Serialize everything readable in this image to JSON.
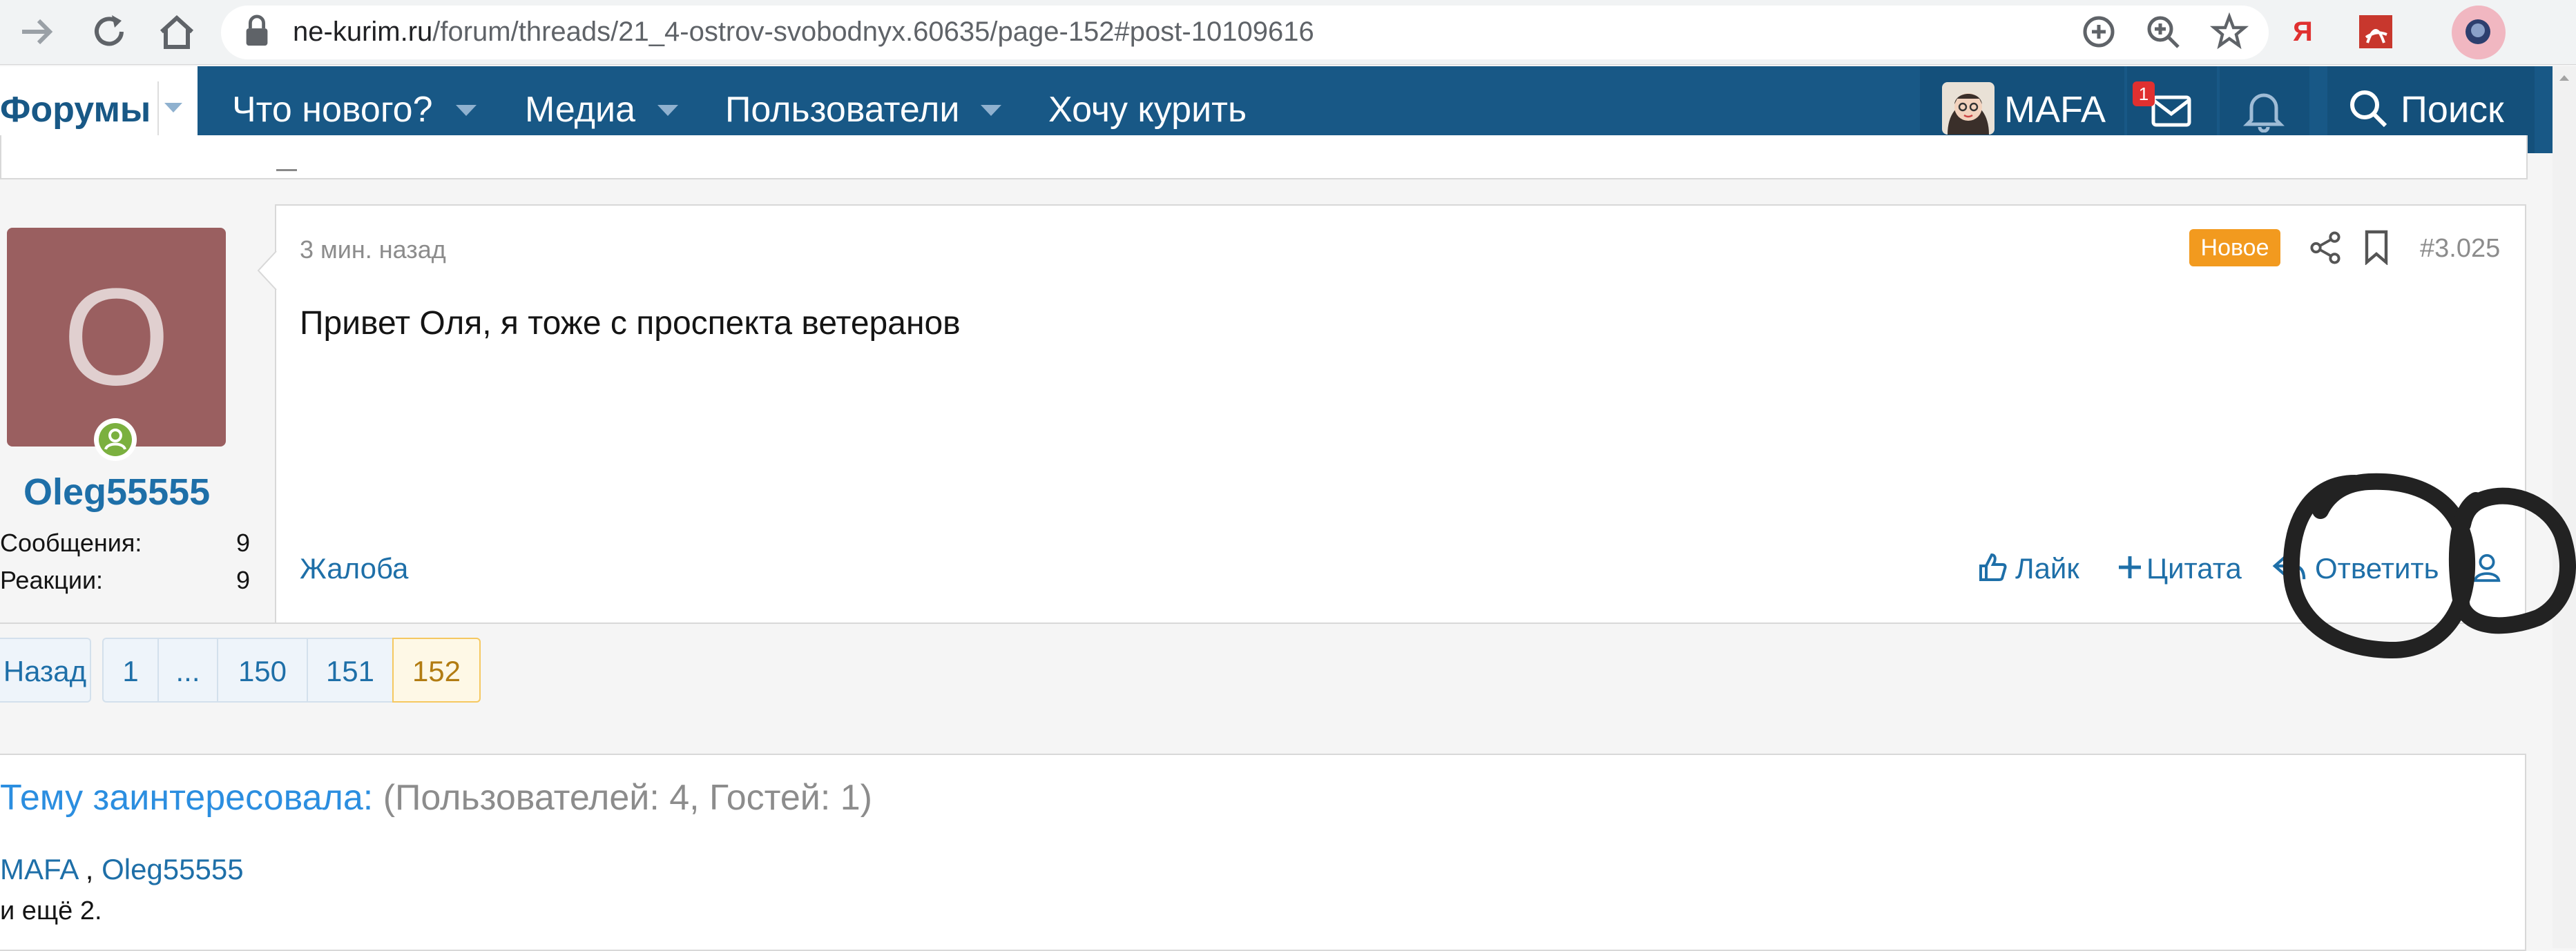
{
  "browser": {
    "url_host": "ne-kurim.ru",
    "url_path": "/forum/threads/21_4-ostrov-svobodnyx.60635/page-152#post-10109616",
    "yandex_glyph": "Я"
  },
  "forum_nav": {
    "forums_label": "Форумы",
    "items": [
      {
        "label": "Что нового?"
      },
      {
        "label": "Медиа"
      },
      {
        "label": "Пользователи"
      },
      {
        "label": "Хочу курить"
      }
    ],
    "user_name": "MAFA",
    "inbox_badge": "1",
    "search_label": "Поиск"
  },
  "post": {
    "author_initial": "O",
    "author_name": "Oleg55555",
    "stats": [
      {
        "label": "Сообщения:",
        "value": "9"
      },
      {
        "label": "Реакции:",
        "value": "9"
      }
    ],
    "time": "3 мин. назад",
    "new_badge": "Новое",
    "number": "#3.025",
    "body": "Привет Оля, я тоже с проспекта ветеранов",
    "report_label": "Жалоба",
    "like_label": "Лайк",
    "quote_label": "Цитата",
    "reply_label": "Ответить"
  },
  "pagination": {
    "prev_label": "Назад",
    "pages": [
      "1",
      "...",
      "150",
      "151",
      "152"
    ],
    "current_page": "152"
  },
  "viewers": {
    "title_link": "Тему заинтересовала:",
    "title_count": "(Пользователей: 4, Гостей: 1)",
    "users": [
      "MAFA",
      "Oleg55555"
    ],
    "separator": ",",
    "more": "и ещё 2."
  },
  "colors": {
    "nav_bg": "#185886",
    "link": "#1e6fa8",
    "new_badge": "#f29a1f",
    "avatar_bg": "#9a5f60",
    "online": "#7bb03f"
  }
}
